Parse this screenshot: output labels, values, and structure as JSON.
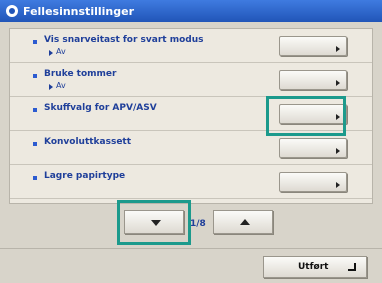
{
  "title": "Fellesinnstillinger",
  "colors": {
    "title_bar": "#2a63cc",
    "label_text": "#1f3f9a",
    "highlight": "#1c9a8c"
  },
  "icons": {
    "title": "settings-icon",
    "row_bullet": "square-bullet-icon",
    "setting_button": "right-arrow-icon"
  },
  "settings": [
    {
      "label": "Vis snarveitast for svart modus",
      "value": "Av"
    },
    {
      "label": "Bruke tommer",
      "value": "Av"
    },
    {
      "label": "Skuffvalg for APV/ASV",
      "value": ""
    },
    {
      "label": "Konvoluttkassett",
      "value": ""
    },
    {
      "label": "Lagre papirtype",
      "value": ""
    }
  ],
  "pager": {
    "page_text": "1/8",
    "current_page": 1,
    "total_pages": 8
  },
  "done_label": "Utført"
}
